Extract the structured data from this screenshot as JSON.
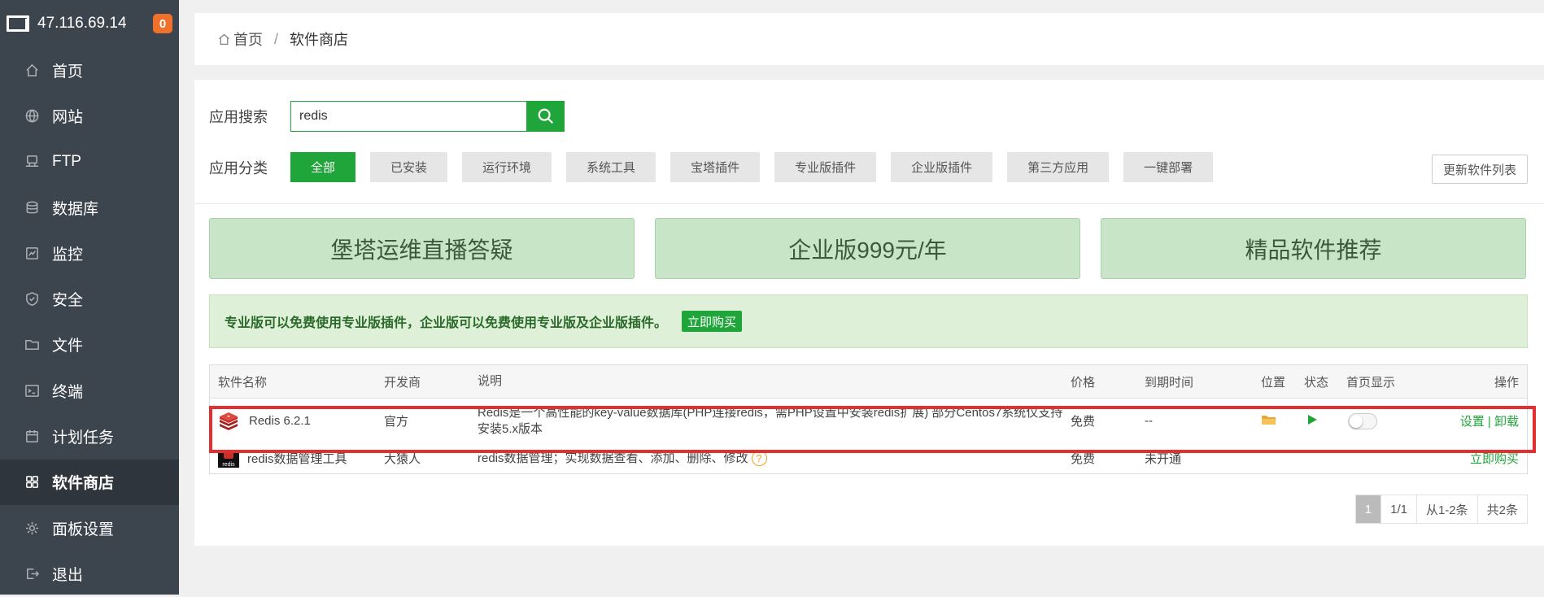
{
  "server": {
    "ip": "47.116.69.14",
    "badge": "0"
  },
  "sidebar": {
    "items": [
      {
        "label": "首页",
        "icon": "home-icon"
      },
      {
        "label": "网站",
        "icon": "globe-icon"
      },
      {
        "label": "FTP",
        "icon": "ftp-icon"
      },
      {
        "label": "数据库",
        "icon": "database-icon"
      },
      {
        "label": "监控",
        "icon": "monitor-icon"
      },
      {
        "label": "安全",
        "icon": "shield-icon"
      },
      {
        "label": "文件",
        "icon": "folder-icon"
      },
      {
        "label": "终端",
        "icon": "terminal-icon"
      },
      {
        "label": "计划任务",
        "icon": "calendar-icon"
      },
      {
        "label": "软件商店",
        "icon": "apps-icon",
        "active": true
      },
      {
        "label": "面板设置",
        "icon": "gear-icon"
      },
      {
        "label": "退出",
        "icon": "logout-icon"
      }
    ]
  },
  "breadcrumb": {
    "home": "首页",
    "sep": "/",
    "current": "软件商店"
  },
  "search": {
    "label": "应用搜索",
    "value": "redis"
  },
  "category": {
    "label": "应用分类",
    "items": [
      "全部",
      "已安装",
      "运行环境",
      "系统工具",
      "宝塔插件",
      "专业版插件",
      "企业版插件",
      "第三方应用",
      "一键部署"
    ],
    "active_index": 0,
    "refresh": "更新软件列表"
  },
  "banners": [
    "堡塔运维直播答疑",
    "企业版999元/年",
    "精品软件推荐"
  ],
  "notice": {
    "text": "专业版可以免费使用专业版插件，企业版可以免费使用专业版及企业版插件。",
    "button": "立即购买"
  },
  "table": {
    "headers": {
      "name": "软件名称",
      "dev": "开发商",
      "desc": "说明",
      "price": "价格",
      "expire": "到期时间",
      "location": "位置",
      "status": "状态",
      "home": "首页显示",
      "ops": "操作"
    },
    "rows": [
      {
        "name": "Redis 6.2.1",
        "dev": "官方",
        "desc": "Redis是一个高性能的key-value数据库(PHP连接redis，需PHP设置中安装redis扩展) 部分Centos7系统仅支持安装5.x版本",
        "price": "免费",
        "expire": "--",
        "op_settings": "设置",
        "op_sep": "|",
        "op_uninstall": "卸载"
      },
      {
        "name": "redis数据管理工具",
        "dev": "大猿人",
        "icon_text": "redis",
        "desc": "redis数据管理；实现数据查看、添加、删除、修改",
        "help": "?",
        "price": "免费",
        "expire": "未开通",
        "op_buy": "立即购买"
      }
    ]
  },
  "pager": {
    "current": "1",
    "pages": "1/1",
    "range": "从1-2条",
    "total": "共2条"
  },
  "colors": {
    "accent": "#20a53a",
    "sidebar": "#3c444d",
    "highlight": "#e23030"
  }
}
